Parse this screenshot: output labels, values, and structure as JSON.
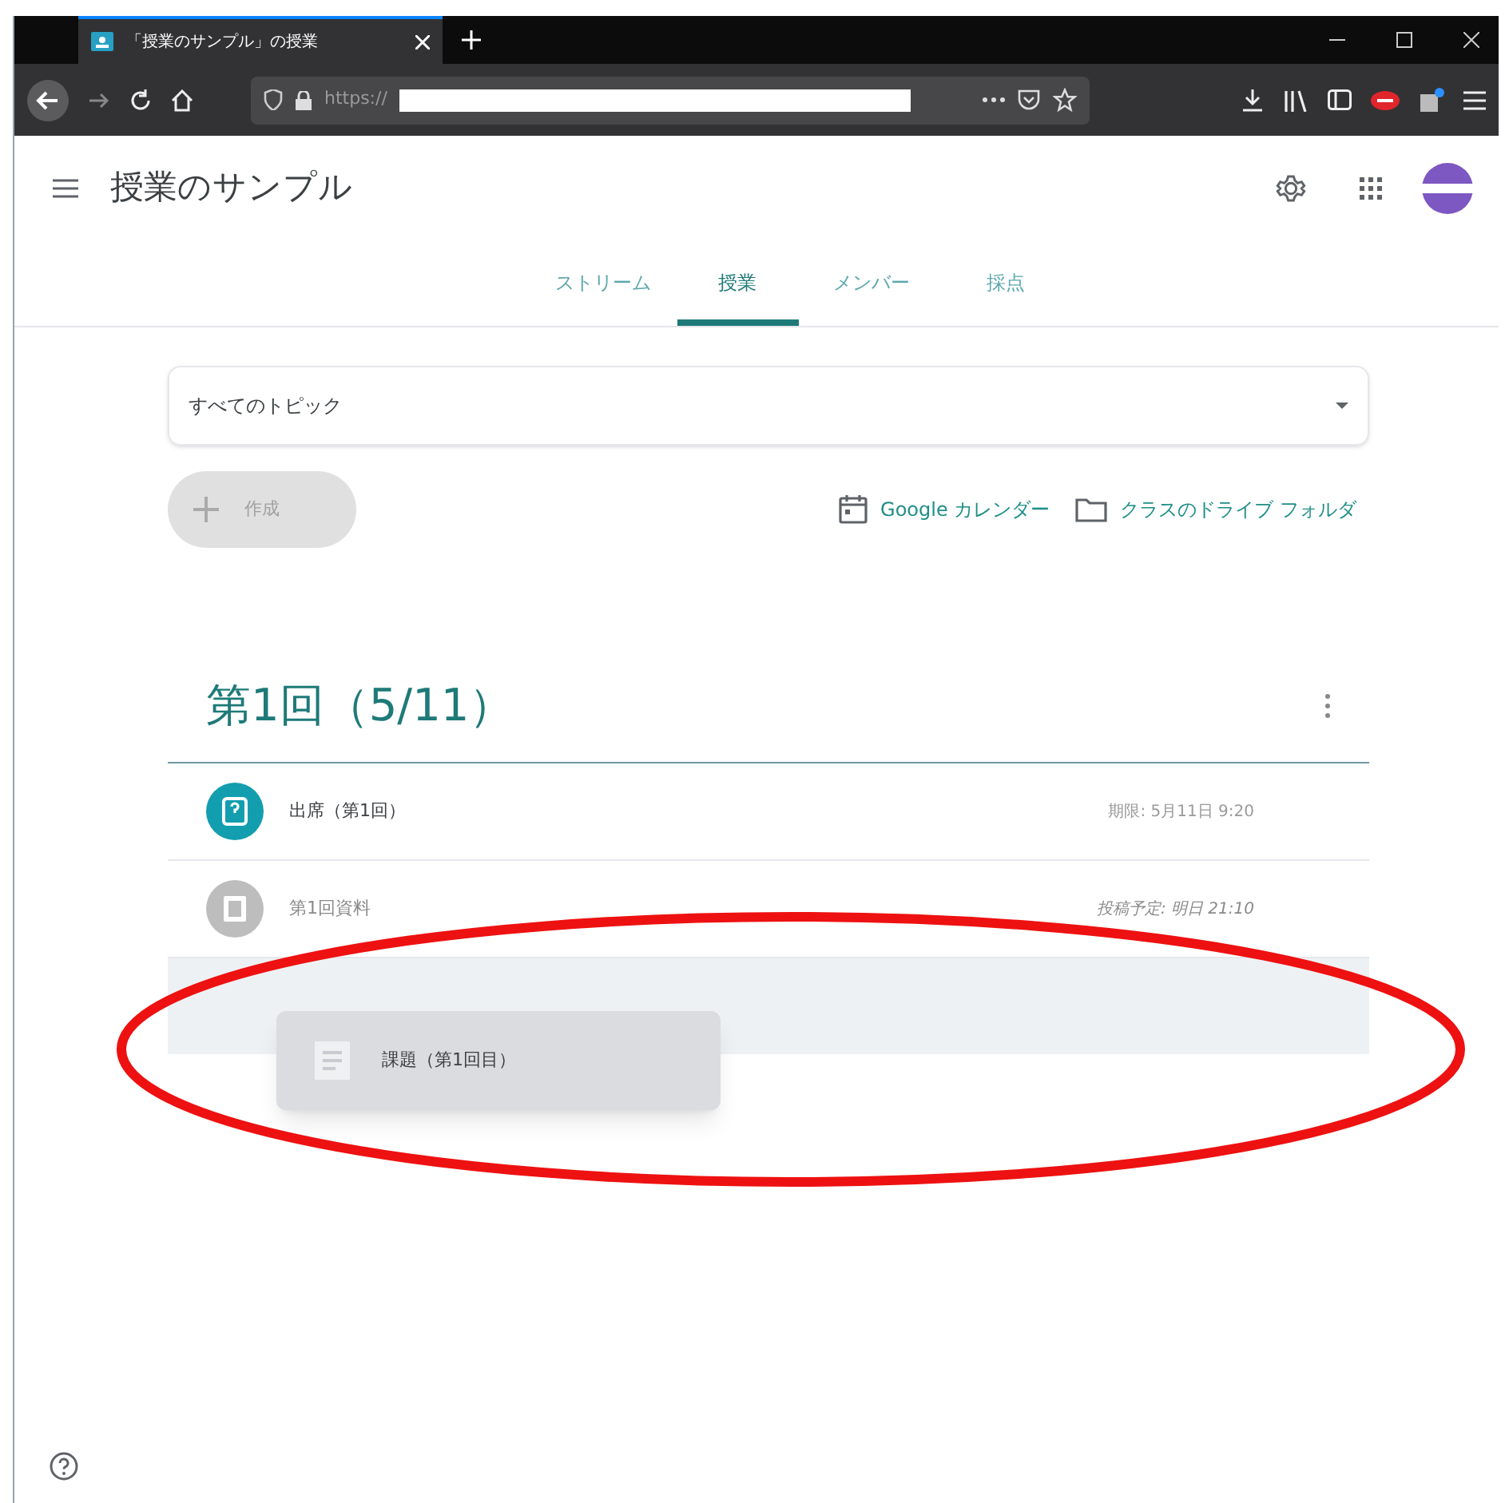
{
  "browser": {
    "tab_title": "「授業のサンプル」の授業",
    "url": "https://"
  },
  "app": {
    "title": "授業のサンプル"
  },
  "tabs": [
    {
      "label": "ストリーム",
      "selected": false
    },
    {
      "label": "授業",
      "selected": true
    },
    {
      "label": "メンバー",
      "selected": false
    },
    {
      "label": "採点",
      "selected": false
    }
  ],
  "topic_filter": {
    "value": "すべてのトピック"
  },
  "create_button": {
    "label": "作成",
    "disabled": true
  },
  "links": [
    {
      "kind": "calendar",
      "label": "Google カレンダー"
    },
    {
      "kind": "folder",
      "label": "クラスのドライブ フォルダ"
    }
  ],
  "topic": {
    "title": "第1回（5/11）",
    "items": [
      {
        "kind": "question",
        "title": "出席（第1回）",
        "due": "期限: 5月11日 9:20",
        "scheduled": false
      },
      {
        "kind": "material",
        "title": "第1回資料",
        "due": "投稿予定: 明日 21:10",
        "scheduled": true
      }
    ]
  },
  "dragged_item": {
    "kind": "assignment",
    "title": "課題（第1回目）"
  }
}
